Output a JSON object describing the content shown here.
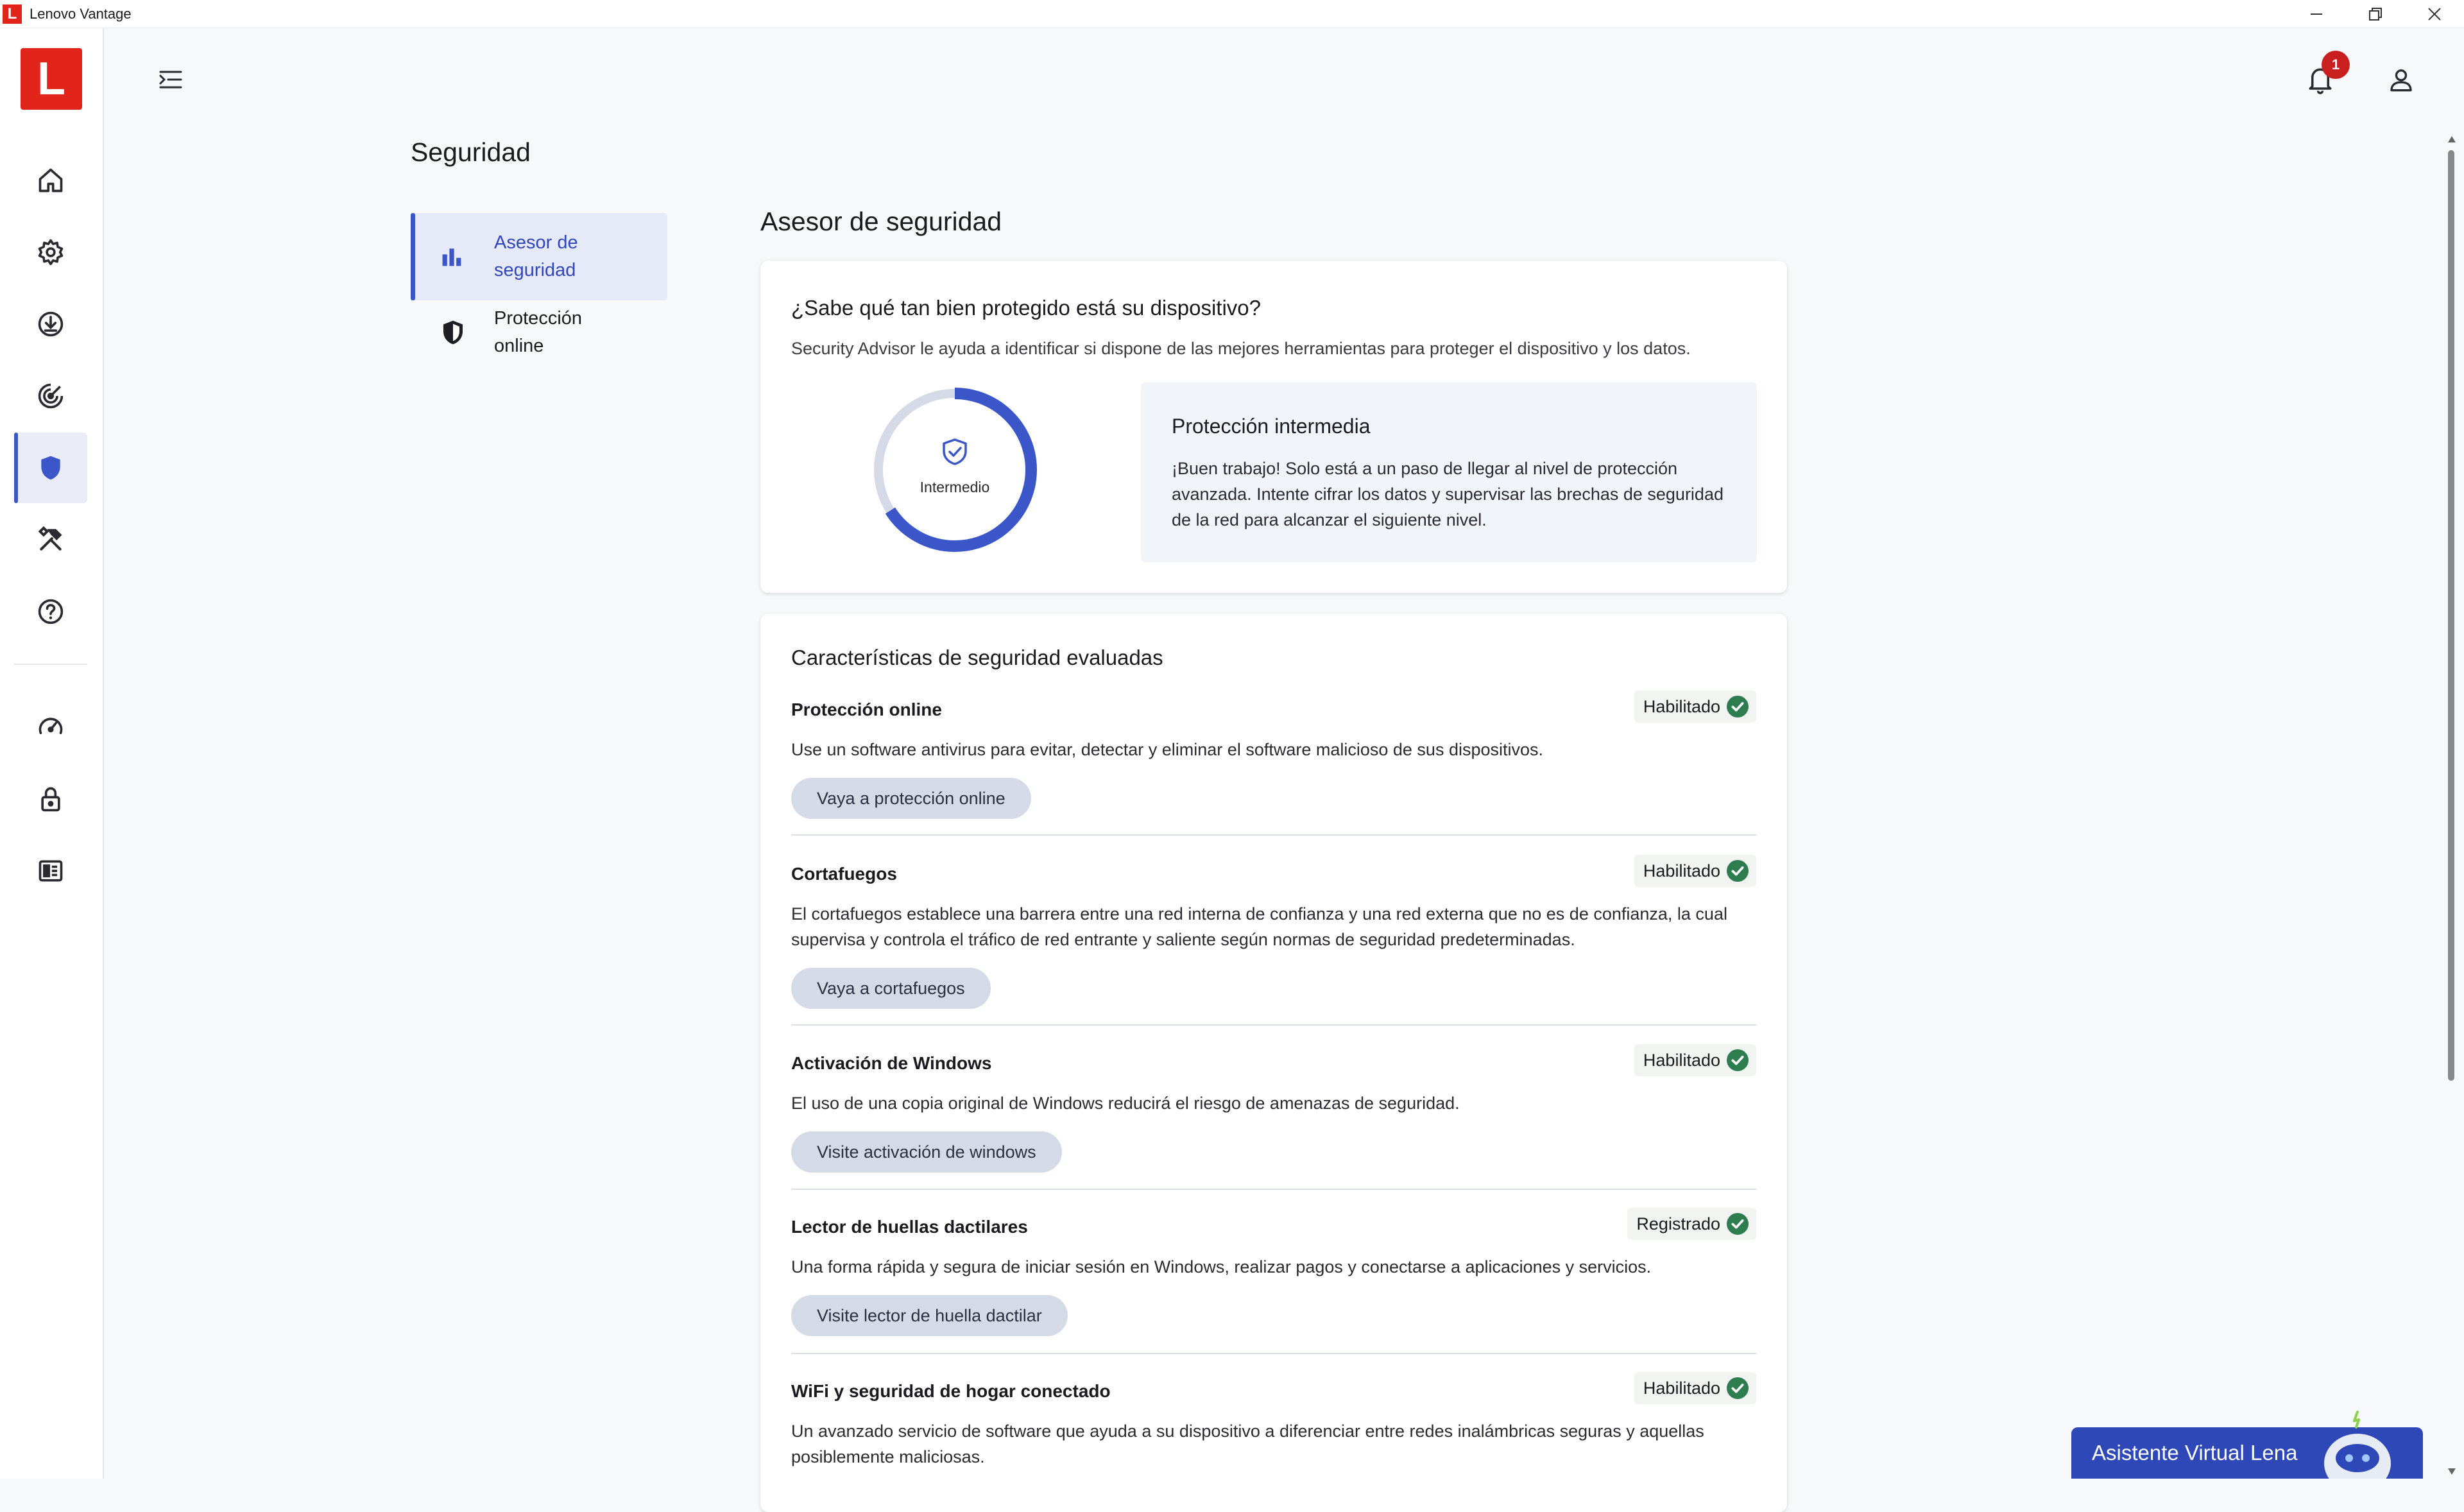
{
  "window": {
    "title": "Lenovo Vantage",
    "logo_letter": "L",
    "controls": [
      "minimize-icon",
      "restore-icon",
      "close-icon"
    ]
  },
  "rail": {
    "logo_letter": "L",
    "items": [
      {
        "icon": "home-icon",
        "active": false
      },
      {
        "icon": "gear-icon",
        "active": false
      },
      {
        "icon": "download-icon",
        "active": false
      },
      {
        "icon": "target-icon",
        "active": false
      },
      {
        "icon": "shield-icon",
        "active": true
      },
      {
        "icon": "tools-icon",
        "active": false
      },
      {
        "icon": "help-icon",
        "active": false
      },
      {
        "icon": "speedometer-icon",
        "active": false
      },
      {
        "icon": "lock-icon",
        "active": false
      },
      {
        "icon": "grid-app-icon",
        "active": false
      }
    ]
  },
  "header": {
    "notifications_count": "1",
    "icons": [
      "menu-expand-icon",
      "bell-icon",
      "account-icon"
    ]
  },
  "page": {
    "title": "Seguridad"
  },
  "subnav": {
    "items": [
      {
        "label": "Asesor de seguridad",
        "icon": "bar-chart-icon",
        "active": true
      },
      {
        "label": "Protección online",
        "icon": "shield-half-icon",
        "active": false
      }
    ]
  },
  "advisor": {
    "section_title": "Asesor de seguridad",
    "card_title": "¿Sabe qué tan bien protegido está su dispositivo?",
    "card_subtitle": "Security Advisor le ayuda a identificar si dispone de las mejores herramientas para proteger el dispositivo y los datos.",
    "gauge_label": "Intermedio",
    "gauge_fraction": 0.66,
    "level_title": "Protección intermedia",
    "level_text": "¡Buen trabajo! Solo está a un paso de llegar al nivel de protección avanzada. Intente cifrar los datos y supervisar las brechas de seguridad de la red para alcanzar el siguiente nivel."
  },
  "features": {
    "title": "Características de seguridad evaluadas",
    "items": [
      {
        "name": "Protección online",
        "status": "Habilitado",
        "description": "Use un software antivirus para evitar, detectar y eliminar el software malicioso de sus dispositivos.",
        "button": "Vaya a protección online"
      },
      {
        "name": "Cortafuegos",
        "status": "Habilitado",
        "description": "El cortafuegos establece una barrera entre una red interna de confianza y una red externa que no es de confianza, la cual supervisa y controla el tráfico de red entrante y saliente según normas de seguridad predeterminadas.",
        "button": "Vaya a cortafuegos"
      },
      {
        "name": "Activación de Windows",
        "status": "Habilitado",
        "description": "El uso de una copia original de Windows reducirá el riesgo de amenazas de seguridad.",
        "button": "Visite activación de windows"
      },
      {
        "name": "Lector de huellas dactilares",
        "status": "Registrado",
        "description": "Una forma rápida y segura de iniciar sesión en Windows, realizar pagos y conectarse a aplicaciones y servicios.",
        "button": "Visite lector de huella dactilar"
      },
      {
        "name": "WiFi y seguridad de hogar conectado",
        "status": "Habilitado",
        "description": "Un avanzado servicio de software que ayuda a su dispositivo a diferenciar entre redes inalámbricas seguras y aquellas posiblemente maliciosas."
      }
    ]
  },
  "assistant": {
    "label": "Asistente Virtual Lena"
  },
  "colors": {
    "accent": "#3a56c8",
    "brand_red": "#e1251b",
    "status_green": "#2e7d4f",
    "button_bg": "#d4dae6"
  }
}
